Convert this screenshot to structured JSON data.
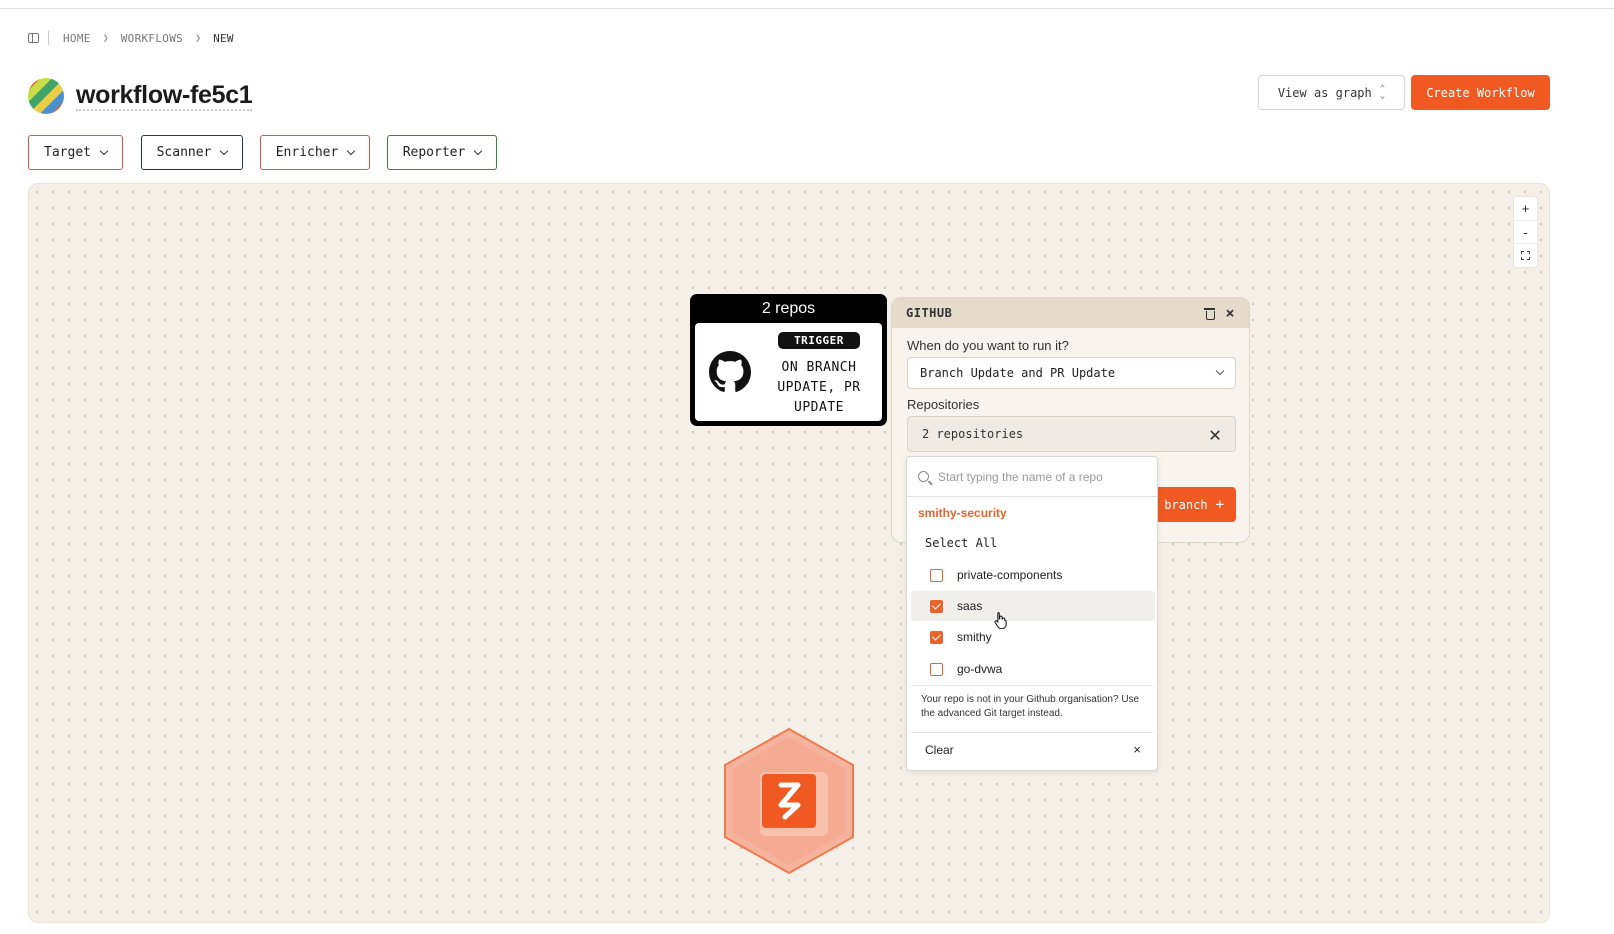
{
  "breadcrumb": {
    "items": [
      "HOME",
      "WORKFLOWS"
    ],
    "current": "NEW"
  },
  "header": {
    "title": "workflow-fe5c1",
    "view_label": "View as graph",
    "create_label": "Create Workflow"
  },
  "categories": {
    "target": "Target",
    "scanner": "Scanner",
    "enricher": "Enricher",
    "reporter": "Reporter"
  },
  "colors": {
    "accent": "#f05a22",
    "target_border": "#d9534f",
    "scanner_border": "#1e3a4c",
    "enricher_border": "#d9534f",
    "reporter_border": "#2f8a3b",
    "canvas_bg": "#f5f0e7"
  },
  "zoom": {
    "in": "+",
    "out": "-"
  },
  "node": {
    "header": "2 repos",
    "badge": "TRIGGER",
    "text": "ON BRANCH UPDATE, PR UPDATE",
    "icon": "github-icon"
  },
  "panel": {
    "title": "GITHUB",
    "when_label": "When do you want to run it?",
    "when_value": "Branch Update and PR Update",
    "repos_label": "Repositories",
    "repos_value": "2 repositories",
    "branch_button": "branch",
    "branch_plus": "+",
    "close": "×"
  },
  "dropdown": {
    "placeholder": "Start typing the name of a repo",
    "group": "smithy-security",
    "select_all": "Select All",
    "items": [
      {
        "label": "private-components",
        "checked": false
      },
      {
        "label": "saas",
        "checked": true
      },
      {
        "label": "smithy",
        "checked": true
      },
      {
        "label": "go-dvwa",
        "checked": false
      }
    ],
    "note": "Your repo is not in your Github organisation? Use the advanced Git target instead.",
    "clear": "Clear",
    "clear_x": "×"
  }
}
